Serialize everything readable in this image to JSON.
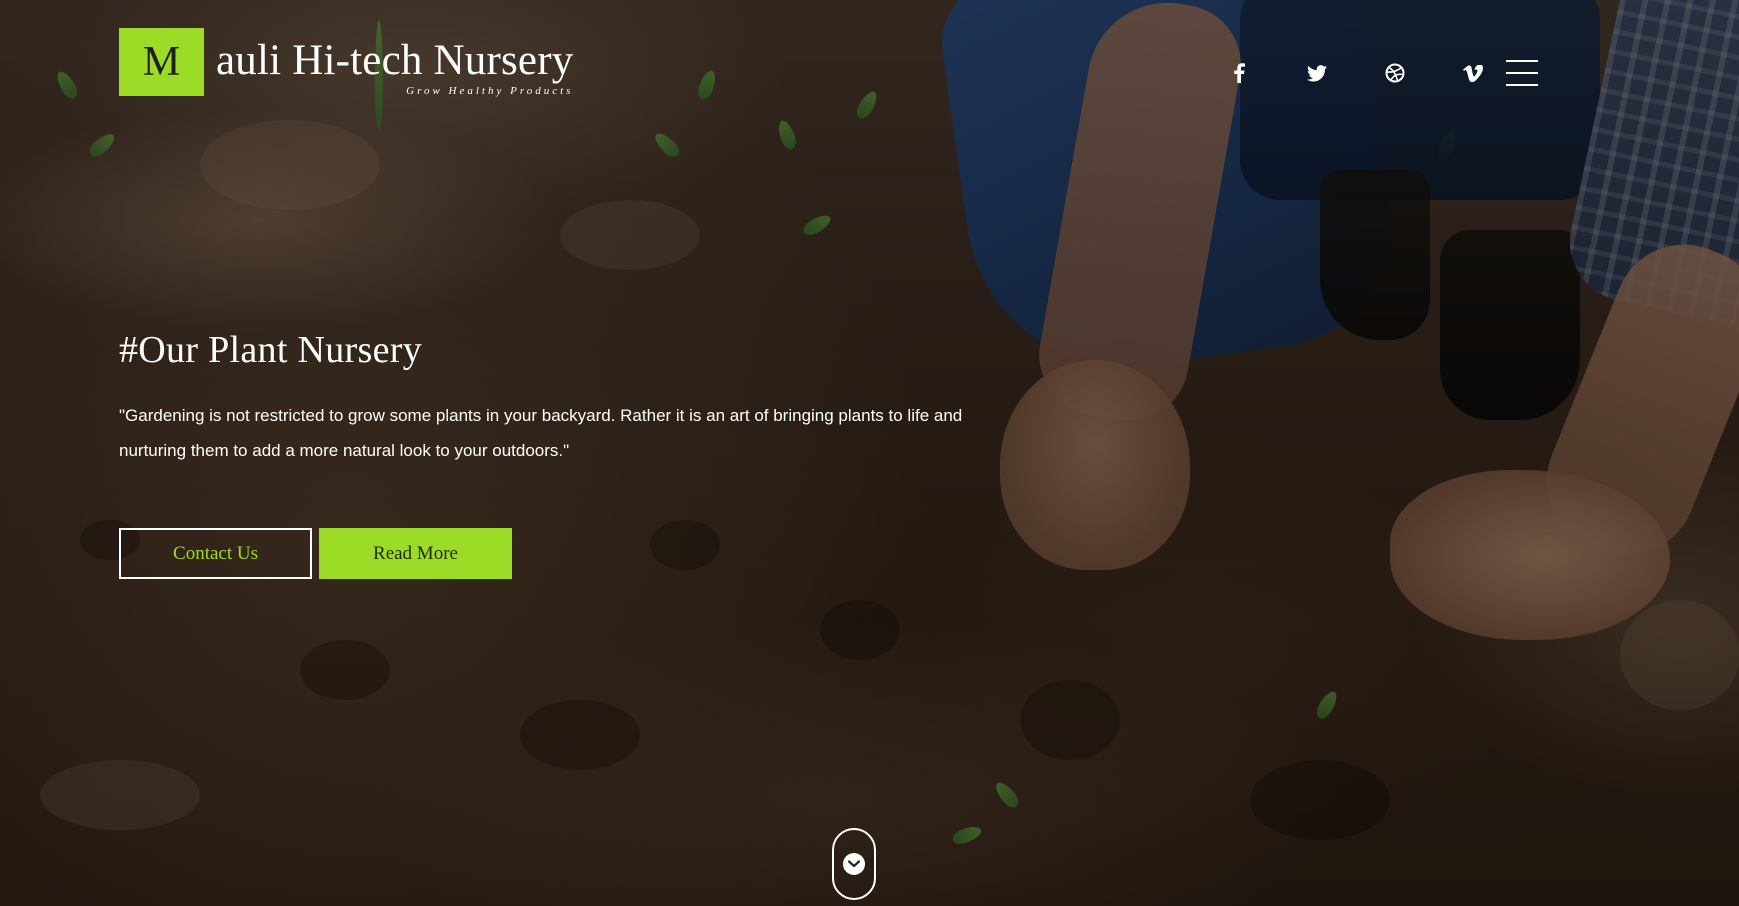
{
  "logo": {
    "initial": "M",
    "name": "auli Hi-tech Nursery",
    "tagline": "Grow Healthy Products"
  },
  "social": [
    {
      "name": "facebook-icon"
    },
    {
      "name": "twitter-icon"
    },
    {
      "name": "dribbble-icon"
    },
    {
      "name": "vimeo-icon"
    }
  ],
  "menu_icon": "hamburger-menu-icon",
  "hero": {
    "title": "#Our Plant Nursery",
    "quote": "\"Gardening is not restricted to grow some plants in your backyard. Rather it is an art of bringing plants to life and nurturing them to add a more natural look to your outdoors.\"",
    "buttons": {
      "contact": "Contact Us",
      "read_more": "Read More"
    }
  },
  "scroll_icon": "chevron-down-icon",
  "colors": {
    "accent": "#9ddc26",
    "text": "#ffffff"
  }
}
